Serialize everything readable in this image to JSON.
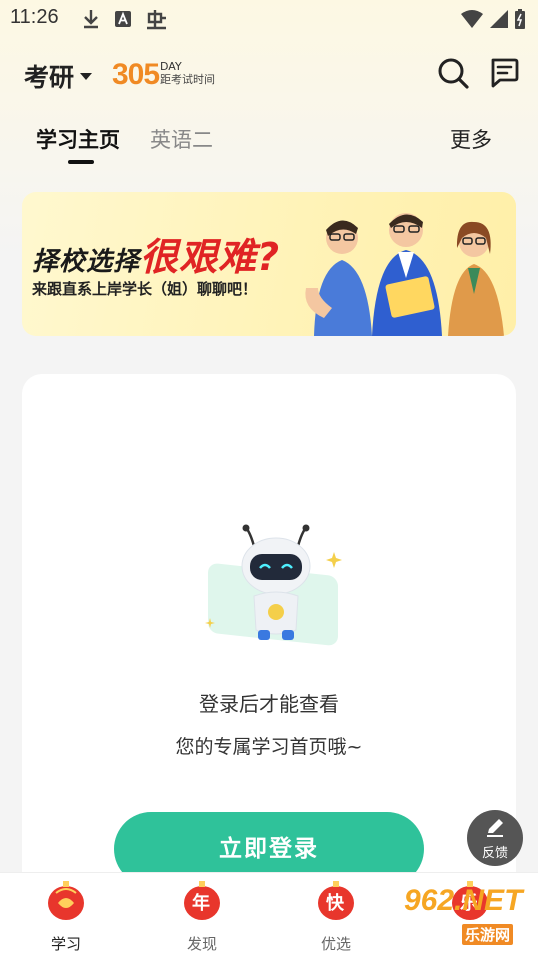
{
  "status_bar": {
    "time": "11:26",
    "icons": [
      "download-icon",
      "text-a-icon",
      "bug-icon",
      "wifi-icon",
      "signal-icon",
      "battery-icon"
    ]
  },
  "header": {
    "exam": "考研",
    "countdown_days": "305",
    "day_unit": "DAY",
    "day_caption": "距考试时间",
    "search_icon": "search-icon",
    "message_icon": "message-icon"
  },
  "tabs": {
    "items": [
      {
        "label": "学习主页",
        "active": true
      },
      {
        "label": "英语二",
        "active": false
      }
    ],
    "more": "更多"
  },
  "banner": {
    "title_prefix": "择校选择",
    "title_highlight": "很艰难?",
    "subtitle": "来跟直系上岸学长（姐）聊聊吧！"
  },
  "empty_state": {
    "line1": "登录后才能查看",
    "line2": "您的专属学习首页哦~",
    "login_button": "立即登录"
  },
  "feedback": {
    "label": "反馈"
  },
  "tabbar": {
    "items": [
      {
        "label": "学习",
        "icon_char": "",
        "active": true
      },
      {
        "label": "发现",
        "icon_char": "年",
        "active": false
      },
      {
        "label": "优选",
        "icon_char": "快",
        "active": false
      },
      {
        "label": "",
        "icon_char": "乐",
        "active": false
      }
    ]
  },
  "watermark": {
    "text": "962.NET",
    "sub": "乐游网"
  },
  "colors": {
    "accent": "#2fc29a",
    "countdown": "#f08a24",
    "highlight": "#e02424"
  }
}
